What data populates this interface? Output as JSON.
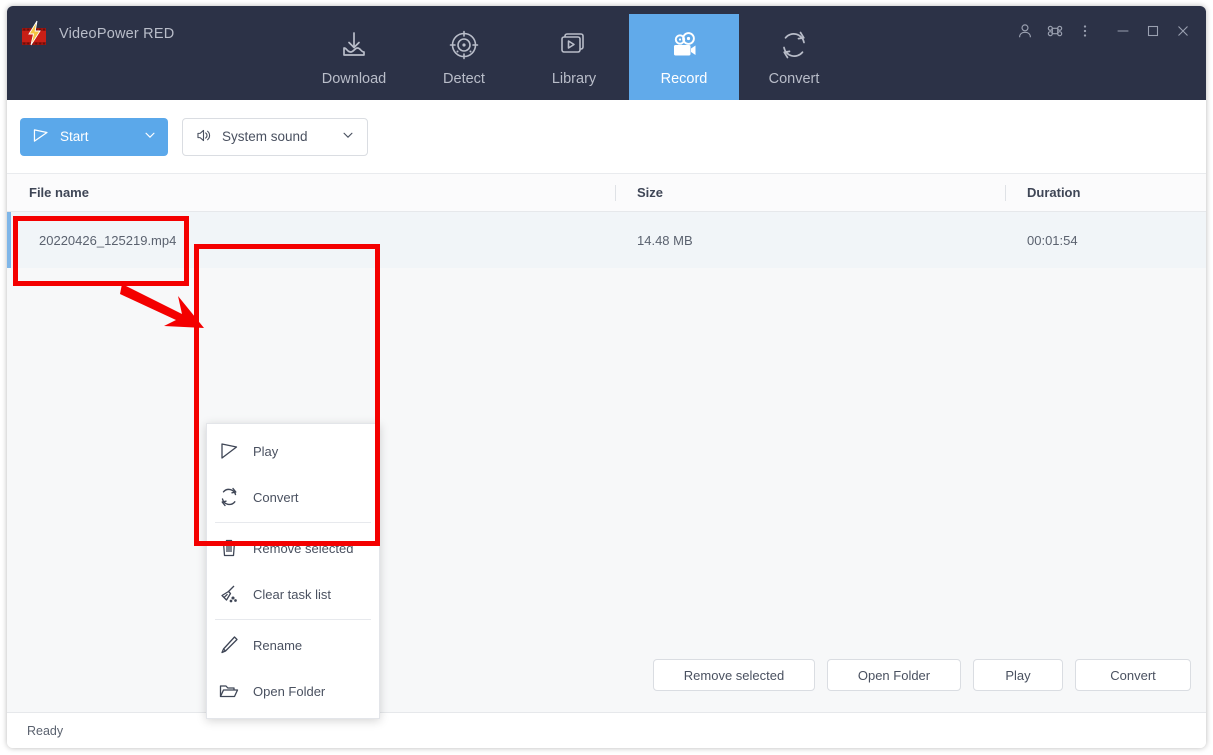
{
  "app": {
    "brand_name": "VideoPower RED",
    "logo_icon": "videopower-red-logo"
  },
  "titlebar": {
    "nav_items": [
      {
        "label": "Download",
        "icon": "download-icon",
        "active": false
      },
      {
        "label": "Detect",
        "icon": "detect-icon",
        "active": false
      },
      {
        "label": "Library",
        "icon": "library-icon",
        "active": false
      },
      {
        "label": "Record",
        "icon": "record-camera-icon",
        "active": true
      },
      {
        "label": "Convert",
        "icon": "convert-refresh-icon",
        "active": false
      }
    ],
    "window_controls": [
      {
        "name": "account-icon"
      },
      {
        "name": "apps-grid-icon"
      },
      {
        "name": "more-vertical-icon"
      },
      {
        "name": "minimize-icon"
      },
      {
        "name": "maximize-icon"
      },
      {
        "name": "close-icon"
      }
    ],
    "accent_color": "#61aaea",
    "background_color": "#2c3247"
  },
  "toolbar": {
    "start_label": "Start",
    "start_icon": "play-triangle-icon",
    "start_chevron": "chevron-down-icon",
    "sound_label": "System sound",
    "sound_icon": "speaker-icon",
    "sound_chevron": "chevron-down-icon"
  },
  "table": {
    "columns": [
      "File name",
      "Size",
      "Duration"
    ],
    "rows": [
      {
        "file_name": "20220426_125219.mp4",
        "size": "14.48 MB",
        "duration": "00:01:54",
        "selected": true
      }
    ]
  },
  "context_menu": {
    "groups": [
      [
        {
          "label": "Play",
          "icon": "play-triangle-icon"
        },
        {
          "label": "Convert",
          "icon": "convert-refresh-icon"
        }
      ],
      [
        {
          "label": "Remove selected",
          "icon": "trash-icon"
        },
        {
          "label": "Clear task list",
          "icon": "broom-icon"
        }
      ],
      [
        {
          "label": "Rename",
          "icon": "pencil-icon"
        },
        {
          "label": "Open Folder",
          "icon": "folder-icon"
        }
      ]
    ]
  },
  "action_bar": {
    "buttons": [
      {
        "label": "Remove selected"
      },
      {
        "label": "Open Folder"
      },
      {
        "label": "Play"
      },
      {
        "label": "Convert"
      }
    ]
  },
  "status_bar": {
    "text": "Ready"
  },
  "annotations": {
    "color": "#f40000",
    "highlight_file_row": true,
    "highlight_context_menu": true,
    "arrow": "red-arrow-pointing-to-menu"
  }
}
